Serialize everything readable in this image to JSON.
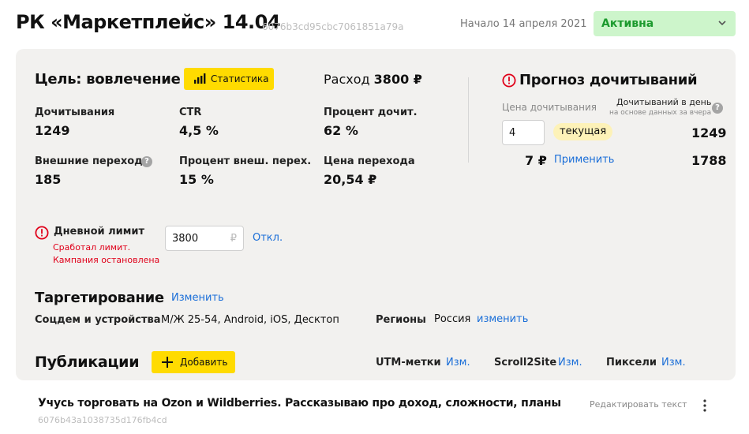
{
  "header": {
    "title": "РК «Маркетплейс» 14.04",
    "campaign_id": "6076b3cd95cbc7061851a79a",
    "start_date": "Начало 14 апреля 2021",
    "status": "Активна"
  },
  "goal": {
    "title": "Цель: вовлечение",
    "stats_button": "Статистика",
    "spend_label": "Расход",
    "spend_value": "3800 ₽"
  },
  "metrics": {
    "reads_label": "Дочитывания",
    "reads_value": "1249",
    "ctr_label": "CTR",
    "ctr_value": "4,5 %",
    "read_pct_label": "Процент дочит.",
    "read_pct_value": "62 %",
    "ext_clicks_label": "Внешние переходы",
    "ext_clicks_value": "185",
    "ext_pct_label": "Процент внеш. перех.",
    "ext_pct_value": "15 %",
    "click_price_label": "Цена перехода",
    "click_price_value": "20,54 ₽"
  },
  "forecast": {
    "title": "Прогноз дочитываний",
    "price_label": "Цена дочитывания",
    "per_day_label": "Дочитываний в день",
    "per_day_sub": "на основе данных за вчера",
    "price_input": "4",
    "current_badge": "текущая",
    "current_value": "1249",
    "alt_price": "7 ₽",
    "apply_link": "Применить",
    "alt_value": "1788"
  },
  "daily_limit": {
    "label": "Дневной лимит",
    "warn_line1": "Сработал лимит.",
    "warn_line2": "Кампания остановлена",
    "input_value": "3800",
    "currency": "₽",
    "off_link": "Откл."
  },
  "targeting": {
    "title": "Таргетирование",
    "edit_link": "Изменить",
    "socdem_label": "Соцдем и устройства",
    "socdem_value": "М/Ж 25-54, Android, iOS, Десктоп",
    "regions_label": "Регионы",
    "regions_value": "Россия",
    "regions_link": "изменить"
  },
  "publications": {
    "title": "Публикации",
    "add_button": "Добавить",
    "utm_label": "UTM-метки",
    "utm_link": "Изм.",
    "scroll_label": "Scroll2Site",
    "scroll_link": "Изм.",
    "pixels_label": "Пиксели",
    "pixels_link": "Изм."
  },
  "publication_card": {
    "title": "Учусь торговать на Ozon и Wildberries. Рассказываю про доход, сложности, планы",
    "id": "6076b43a1038735d176fb4cd",
    "edit_text": "Редактировать текст"
  },
  "colors": {
    "accent_yellow": "#ffdb00",
    "link_blue": "#1a6ed8",
    "status_green_bg": "#cdf5cb",
    "status_green_text": "#1c9a2e",
    "warning_red": "#e0001a",
    "panel_bg": "#f2f1ef"
  }
}
